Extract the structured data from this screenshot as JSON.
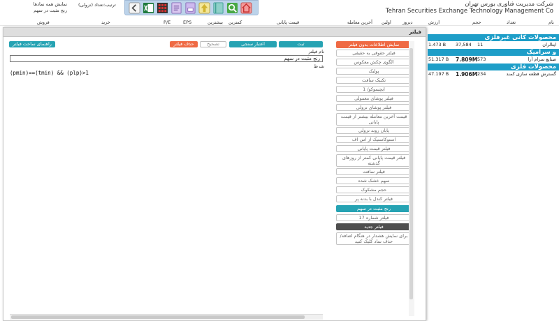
{
  "header": {
    "title_fa": "شرکت مدیریت فناوری بورس تهران",
    "title_en": "Tehran Securities Exchange Technology Management Co",
    "show_all_line1": "نمایش همه نمادها",
    "show_all_line2": "رنج مثبت در سهم",
    "sort_label": "ترتیب:تعداد (نزولی)",
    "toolbar_icons": [
      "arrow-left-icon",
      "excel-icon",
      "grid-icon",
      "report-icon",
      "print-icon",
      "up-arrow-icon",
      "book-icon",
      "search-icon",
      "home-icon"
    ]
  },
  "columns": [
    "نام",
    "تعداد",
    "حجم",
    "ارزش",
    "دیروز",
    "اولین",
    "آخرین معامله",
    "قیمت پایانی",
    "کمترین",
    "بیشترین",
    "EPS",
    "P/E",
    "خرید",
    "فروش"
  ],
  "market": {
    "sections": [
      {
        "title": "محصولات کانی غیرفلزی",
        "rows": [
          {
            "name": "ایتالران",
            "count": "11",
            "volume": "37,584",
            "value": "1.473 B"
          }
        ]
      },
      {
        "title": "و سرامیک",
        "rows": [
          {
            "name": "صنایع سرام آرا",
            "count": "573",
            "volume": "7.809M",
            "value": "51.317 B"
          }
        ]
      },
      {
        "title": "محصولات فلزی",
        "rows": [
          {
            "name": "گسترش قطعه سازی کمند",
            "count": "234",
            "volume": "1.906M",
            "value": "47.197 B"
          }
        ]
      }
    ]
  },
  "dialog": {
    "title": "فیلتر",
    "buttons": {
      "save": "ثبت",
      "backtest": "اعتبار سنجی",
      "edit": "تصحیح",
      "delete": "حذف فیلتر",
      "guide": "راهنمای ساخت فیلتر"
    },
    "name_label": "نام فیلتر",
    "name_value": "رنج مثبت در سهم",
    "condition_label": "شرط",
    "condition_value": "(pmin)==(tmin) && (plp)>1"
  },
  "filters": {
    "items": [
      {
        "label": "نمایش اطلاعات بدون فیلتر",
        "style": "orange"
      },
      {
        "label": "فیلتر حقوقی به حقیقی",
        "style": "normal"
      },
      {
        "label": "الگوی چکش معکوس",
        "style": "normal"
      },
      {
        "label": "پولبک",
        "style": "normal"
      },
      {
        "label": "تکنیک سافت",
        "style": "normal"
      },
      {
        "label": "ایچیموکو/ 1",
        "style": "normal"
      },
      {
        "label": "فیلتر پوشای معمولی",
        "style": "normal"
      },
      {
        "label": "فیلتر پوشای نزولی",
        "style": "normal"
      },
      {
        "label": "قیمت آخرین معامله بیشتر از قیمت پایانی",
        "style": "normal"
      },
      {
        "label": "پایان روند نزولی",
        "style": "normal"
      },
      {
        "label": "استوکاستیک از اس اف",
        "style": "normal"
      },
      {
        "label": "فیلتر قیمت پایانی",
        "style": "normal"
      },
      {
        "label": "فیلتر قیمت پایانی کمتر از روزهای گذشته",
        "style": "normal"
      },
      {
        "label": "فیلتر سافت",
        "style": "normal"
      },
      {
        "label": "سهم خشک شده",
        "style": "normal"
      },
      {
        "label": "حجم مشکوک",
        "style": "normal"
      },
      {
        "label": "فیلتر کندل با بدنه پر",
        "style": "normal"
      },
      {
        "label": "رنج مثبت در سهم",
        "style": "teal"
      },
      {
        "label": "فیلتر شماره 17",
        "style": "normal"
      },
      {
        "label": "فیلتر جدید",
        "style": "dark"
      },
      {
        "label": "برای نمایش هشدار در هنگام اضافه/حذف نماد کلیک کنید",
        "style": "normal"
      }
    ]
  }
}
